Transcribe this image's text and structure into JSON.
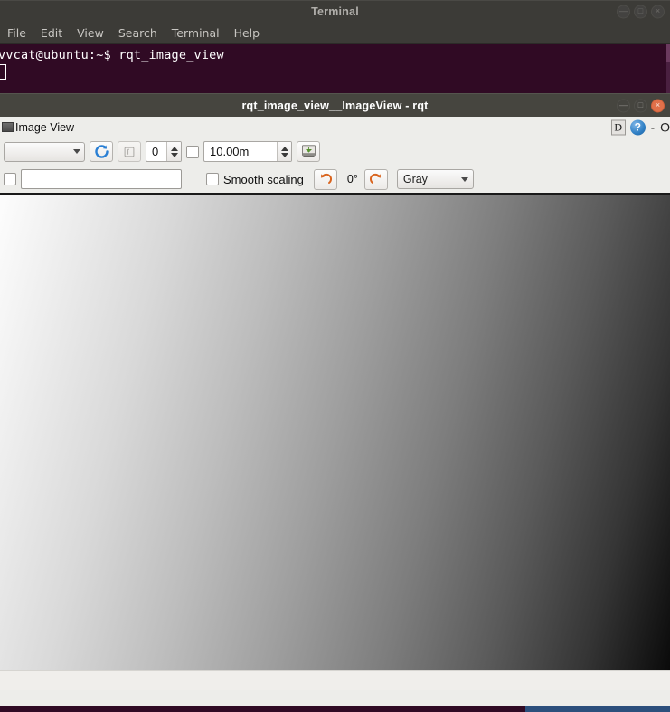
{
  "terminal": {
    "title": "Terminal",
    "menu": [
      "File",
      "Edit",
      "View",
      "Search",
      "Terminal",
      "Help"
    ],
    "prompt_line": "vvcat@ubuntu:~$ rqt_image_view",
    "window_buttons": {
      "minimize": "—",
      "maximize": "□",
      "close": "×"
    }
  },
  "rqt": {
    "title": "rqt_image_view__ImageView - rqt",
    "window_buttons": {
      "minimize": "—",
      "maximize": "□",
      "close": "×"
    },
    "plugin": {
      "tab_label": "Image View",
      "dock_button": "D",
      "help_button": "?",
      "minimize_glyph": "-",
      "close_glyph": "O"
    },
    "toolbar_row1": {
      "topic_combo_value": "",
      "refresh_tooltip": "refresh-topics",
      "publish_button_label": "",
      "index_spin_value": "0",
      "dynamic_range_checked": false,
      "max_depth_value": "10.00m",
      "save_button_label": ""
    },
    "toolbar_row2": {
      "publish_click_checked": false,
      "publish_topic_value": "",
      "smooth_scaling_label": "Smooth scaling",
      "smooth_scaling_checked": false,
      "rotate_ccw_label": "",
      "rotation_degrees": "0°",
      "rotate_cw_label": "",
      "colormap_value": "Gray"
    }
  },
  "image_view": {
    "gradient_description": "grayscale-gradient",
    "colors": {
      "top_left": "#fdfdfd",
      "mid": "#9e9e9e",
      "bottom_right": "#0a0a0a"
    }
  }
}
